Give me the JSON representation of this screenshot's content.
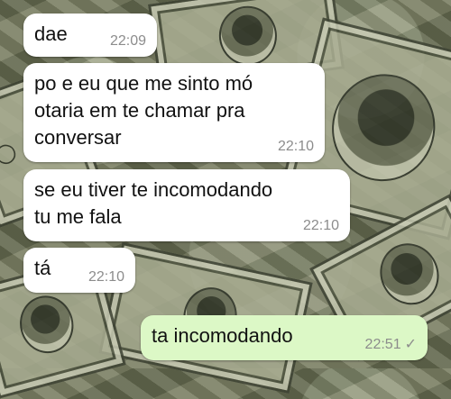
{
  "messages": [
    {
      "text": "dae",
      "time": "22:09",
      "direction": "incoming"
    },
    {
      "text": "po e eu que me sinto mó\notaria em te chamar pra\nconversar",
      "time": "22:10",
      "direction": "incoming"
    },
    {
      "text": "se eu tiver te incomodando\ntu me fala",
      "time": "22:10",
      "direction": "incoming"
    },
    {
      "text": "tá",
      "time": "22:10",
      "direction": "incoming"
    },
    {
      "text": "ta incomodando",
      "time": "22:51",
      "direction": "outgoing",
      "status_icon": "single-check-icon"
    }
  ],
  "background": {
    "description_icon": "money-bills-wallpaper"
  },
  "colors": {
    "incoming_bubble": "#ffffff",
    "outgoing_bubble": "#dcf8c6",
    "timestamp": "#8c8c8c"
  },
  "glyphs": {
    "check": "✓"
  }
}
